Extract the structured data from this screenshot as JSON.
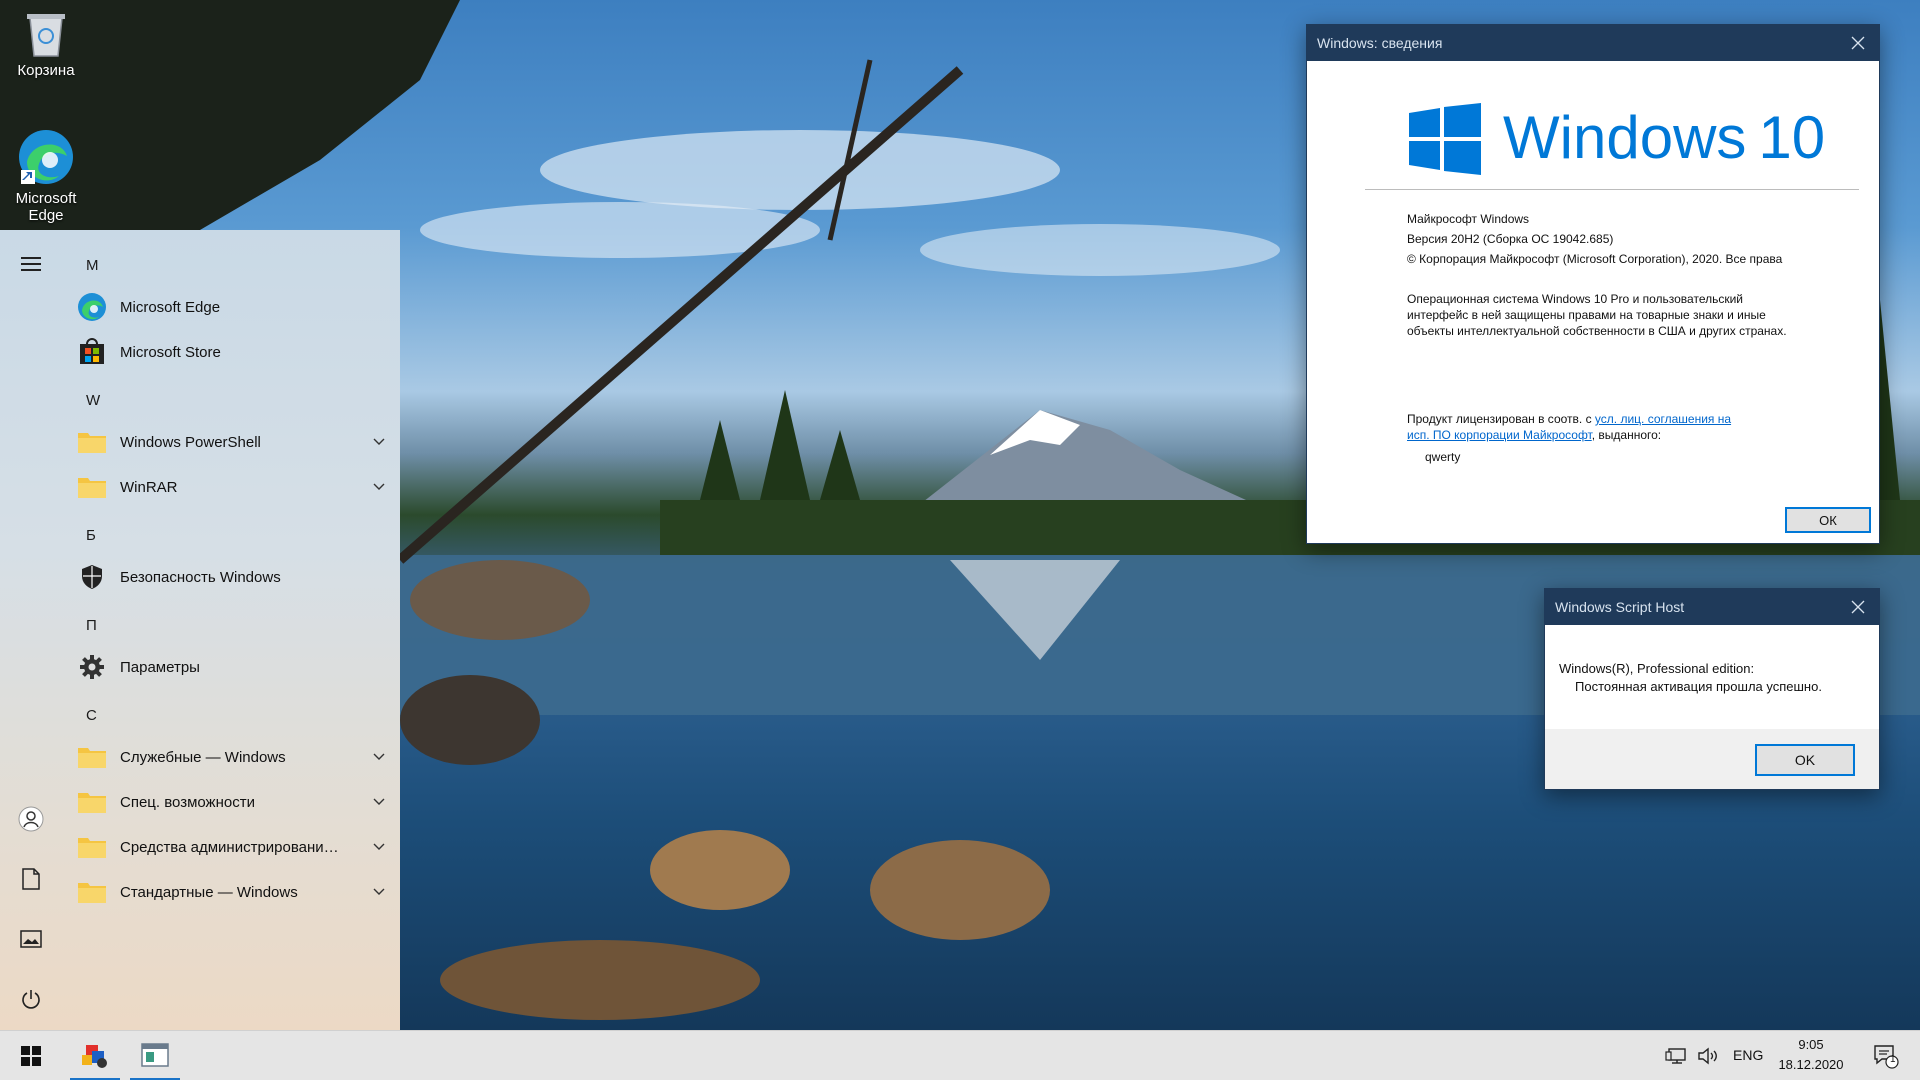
{
  "desktop": {
    "icons": [
      {
        "label": "Корзина"
      },
      {
        "label": "Microsoft Edge"
      }
    ]
  },
  "start_menu": {
    "groups": [
      {
        "letter": "M"
      },
      {
        "letter": "W"
      },
      {
        "letter": "Б"
      },
      {
        "letter": "П"
      },
      {
        "letter": "С"
      }
    ],
    "apps": [
      {
        "label": "Microsoft Edge",
        "icon": "edge-icon"
      },
      {
        "label": "Microsoft Store",
        "icon": "store-icon"
      },
      {
        "label": "Windows PowerShell",
        "icon": "folder-icon"
      },
      {
        "label": "WinRAR",
        "icon": "folder-icon"
      },
      {
        "label": "Безопасность Windows",
        "icon": "shield-icon"
      },
      {
        "label": "Параметры",
        "icon": "gear-icon"
      },
      {
        "label": "Служебные — Windows",
        "icon": "folder-icon"
      },
      {
        "label": "Спец. возможности",
        "icon": "folder-icon"
      },
      {
        "label": "Средства администрирования Windows",
        "icon": "folder-icon"
      },
      {
        "label": "Стандартные — Windows",
        "icon": "folder-icon"
      }
    ],
    "rail": [
      "hamburger-icon",
      "user-icon",
      "document-icon",
      "pictures-icon",
      "power-icon"
    ]
  },
  "about_dialog": {
    "title": "Windows: сведения",
    "logo_text": "Windows",
    "logo_version": "10",
    "line1": "Майкрософт Windows",
    "line2": "Версия 20H2 (Сборка ОС 19042.685)",
    "line3": "© Корпорация Майкрософт (Microsoft Corporation), 2020. Все права",
    "para1_l1": "Операционная система Windows 10 Pro и пользовательский",
    "para1_l2": "интерфейс в ней защищены правами на товарные знаки и иные",
    "para1_l3": "объекты интеллектуальной собственности в США и других странах.",
    "license_prefix": "Продукт лицензирован в соотв. с ",
    "license_link1": "усл. лиц. соглашения на",
    "license_link2": "исп. ПО корпорации Майкрософт",
    "license_suffix": ", выданного:",
    "licensee": "qwerty",
    "ok_label": "ОК"
  },
  "wsh_dialog": {
    "title": "Windows Script Host",
    "line1": "Windows(R), Professional edition:",
    "line2": "Постоянная активация прошла успешно.",
    "ok_label": "OK"
  },
  "taskbar": {
    "language": "ENG",
    "time": "9:05",
    "date": "18.12.2020",
    "notification_count": "1"
  },
  "colors": {
    "accent": "#0078d7",
    "dialog_title_bg": "#1f3a5a",
    "folder": "#f5c542",
    "windows_logo": "#0078d7"
  }
}
